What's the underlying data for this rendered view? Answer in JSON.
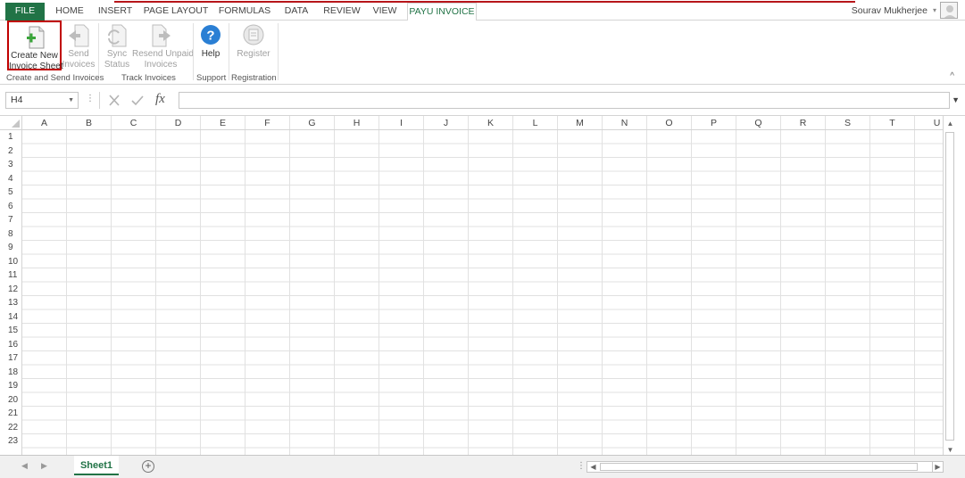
{
  "tabs": {
    "file": "FILE",
    "home": "HOME",
    "insert": "INSERT",
    "page_layout": "PAGE LAYOUT",
    "formulas": "FORMULAS",
    "data": "DATA",
    "review": "REVIEW",
    "view": "VIEW",
    "payu_invoice": "PAYU INVOICE"
  },
  "user": {
    "name": "Sourav Mukherjee"
  },
  "ribbon": {
    "create_new": {
      "line1": "Create New",
      "line2": "Invoice Sheet"
    },
    "send": {
      "line1": "Send",
      "line2": "Invoices"
    },
    "sync": {
      "line1": "Sync",
      "line2": "Status"
    },
    "resend": {
      "line1": "Resend Unpaid",
      "line2": "Invoices"
    },
    "help": {
      "line1": "Help"
    },
    "register": {
      "line1": "Register"
    },
    "groups": {
      "create_send": "Create and Send Invoices",
      "track": "Track Invoices",
      "support": "Support",
      "registration": "Registration"
    }
  },
  "formula_bar": {
    "name_box": "H4",
    "fx": "fx",
    "formula": ""
  },
  "grid": {
    "columns": [
      "A",
      "B",
      "C",
      "D",
      "E",
      "F",
      "G",
      "H",
      "I",
      "J",
      "K",
      "L",
      "M",
      "N",
      "O",
      "P",
      "Q",
      "R",
      "S",
      "T",
      "U"
    ],
    "rows": [
      "1",
      "2",
      "3",
      "4",
      "5",
      "6",
      "7",
      "8",
      "9",
      "10",
      "11",
      "12",
      "13",
      "14",
      "15",
      "16",
      "17",
      "18",
      "19",
      "20",
      "21",
      "22",
      "23"
    ]
  },
  "sheets": {
    "active": "Sheet1"
  },
  "colors": {
    "excel_green": "#217346",
    "highlight_red": "#c00000",
    "help_blue": "#2a7fd4"
  }
}
